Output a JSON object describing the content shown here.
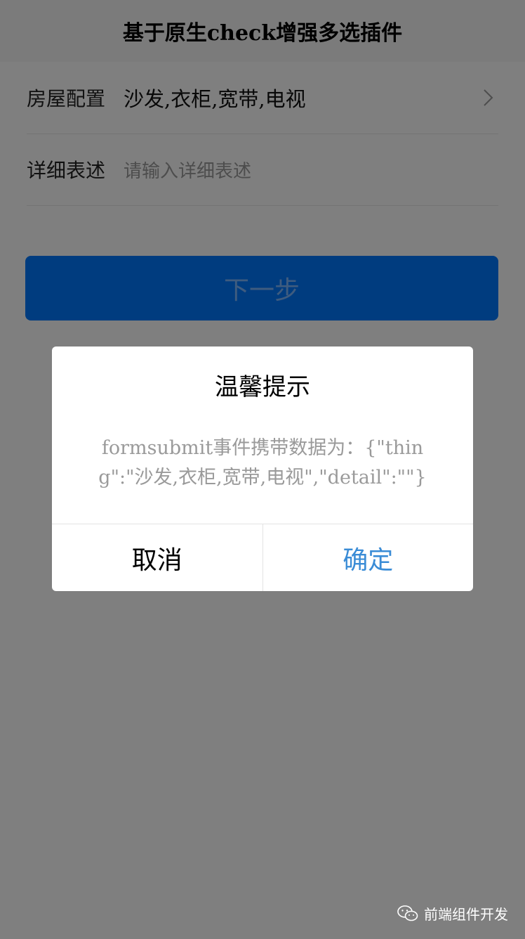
{
  "nav": {
    "title": "基于原生check增强多选插件"
  },
  "form": {
    "config_row": {
      "label": "房屋配置",
      "value": "沙发,衣柜,宽带,电视"
    },
    "detail_row": {
      "label": "详细表述",
      "placeholder": "请输入详细表述"
    },
    "next_button": "下一步"
  },
  "dialog": {
    "title": "温馨提示",
    "content": "formsubmit事件携带数据为：{\"thing\":\"沙发,衣柜,宽带,电视\",\"detail\":\"\"}",
    "cancel": "取消",
    "confirm": "确定"
  },
  "watermark": {
    "text": "前端组件开发",
    "icon": "wechat-icon"
  },
  "colors": {
    "primary": "#0078ff",
    "confirm_text": "#3a8cd6",
    "mask": "rgba(0,0,0,0.5)"
  }
}
